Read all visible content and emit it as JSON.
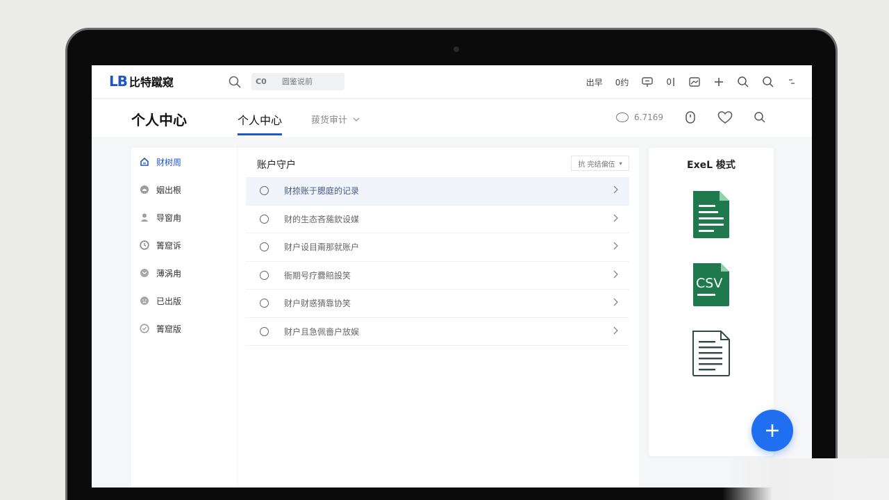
{
  "brand": {
    "mark": "LB",
    "name": "比特蹴窥"
  },
  "search": {
    "tag": "C0",
    "placeholder": "圆鉴说前"
  },
  "top_actions": [
    {
      "label": "出早",
      "icon": ""
    },
    {
      "label": "0约",
      "icon": ""
    },
    {
      "label": "",
      "icon": "chat-icon"
    },
    {
      "label": "0",
      "icon": ""
    },
    {
      "label": "",
      "icon": "window-icon"
    },
    {
      "label": "",
      "icon": "plus-icon"
    },
    {
      "label": "",
      "icon": "search-icon"
    },
    {
      "label": "",
      "icon": "search-icon"
    },
    {
      "label": "",
      "icon": "more-icon"
    }
  ],
  "page": {
    "title": "个人中心",
    "tabs": [
      {
        "label": "个人中心",
        "active": true
      },
      {
        "label": "菝货审计",
        "active": false
      }
    ],
    "status_text": "6.7169"
  },
  "sidebar": {
    "items": [
      {
        "label": "财树周",
        "icon": "home-icon",
        "active": true
      },
      {
        "label": "姻出根",
        "icon": "cloud-icon",
        "active": false
      },
      {
        "label": "导窗甪",
        "icon": "user-icon",
        "active": false
      },
      {
        "label": "箐窟诉",
        "icon": "clock-icon",
        "active": false
      },
      {
        "label": "薄涡甪",
        "icon": "mail-icon",
        "active": false
      },
      {
        "label": "已出版",
        "icon": "sad-face-icon",
        "active": false
      },
      {
        "label": "箐窟版",
        "icon": "check-circle-icon",
        "active": false
      }
    ]
  },
  "main": {
    "title": "账户守户",
    "filter_label": "抗 完结偏伍",
    "rows": [
      {
        "label": "财捺账于腮庭的记录",
        "selected": true
      },
      {
        "label": "财的生态吝葹欽设媒",
        "selected": false
      },
      {
        "label": "财户设目甭那就账户",
        "selected": false
      },
      {
        "label": "衙期号疗爨賠設笑",
        "selected": false
      },
      {
        "label": "财户财惑猜靠协笑",
        "selected": false
      },
      {
        "label": "财户且急佩嗇户放娱",
        "selected": false
      }
    ]
  },
  "export": {
    "title": "ExeL 梭式",
    "files": [
      {
        "icon": "excel-file-icon",
        "label": ""
      },
      {
        "icon": "csv-file-icon",
        "label": "CSV"
      },
      {
        "icon": "text-file-icon",
        "label": ""
      }
    ]
  },
  "fab": {
    "icon": "plus-icon"
  },
  "colors": {
    "accent": "#1f55c8",
    "fab": "#1f6ff0",
    "file_green": "#1e7a4c"
  }
}
